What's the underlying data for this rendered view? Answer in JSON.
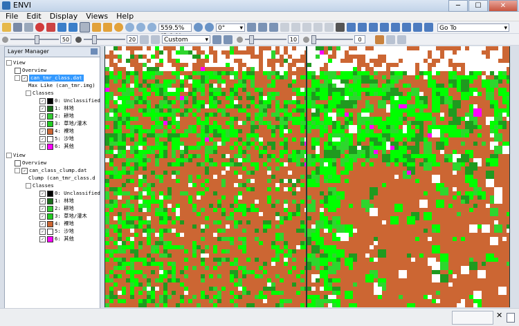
{
  "window": {
    "title": "ENVI",
    "min_label": "─",
    "max_label": "☐",
    "close_label": "✕"
  },
  "menu": [
    "File",
    "Edit",
    "Display",
    "Views",
    "Help"
  ],
  "toolbar": {
    "zoom_value": "559.5% (5.6:1)",
    "rotation_value": "0°",
    "goto_label": "Go To",
    "stretch_value": "Custom",
    "brightness_value": "50",
    "contrast_value": "20",
    "sharpen_value": "10",
    "transparency_value": "0"
  },
  "layer_manager": {
    "title": "Layer Manager",
    "views": [
      {
        "label": "View",
        "overview_label": "Overview",
        "file_label": "can_tmr_class.dat",
        "file_selected": true,
        "sub_label": "Max Like (can_tmr.img)",
        "classes_label": "Classes"
      },
      {
        "label": "View",
        "overview_label": "Overview",
        "file_label": "can_class_clump.dat",
        "file_selected": false,
        "sub_label": "Clump (can_tmr_class.d",
        "classes_label": "Classes"
      }
    ],
    "classes": [
      {
        "label": "0: Unclassified",
        "color": "#000000"
      },
      {
        "label": "1: 林地",
        "color": "#1a6b1a"
      },
      {
        "label": "2: 耕地",
        "color": "#33cc33"
      },
      {
        "label": "3: 草地/灌木",
        "color": "#22cc22"
      },
      {
        "label": "4: 裸地",
        "color": "#cc6633"
      },
      {
        "label": "5: 沙地",
        "color": "#ffffff"
      },
      {
        "label": "6: 其他",
        "color": "#ff00ff"
      }
    ]
  },
  "palette": {
    "background": "#cc6633",
    "forest": "#1f9a1f",
    "farmland": "#2ed62e",
    "grass": "#00ff00",
    "sand": "#ffffff",
    "other": "#ff00ff"
  },
  "status": {
    "close_label": "✕"
  }
}
